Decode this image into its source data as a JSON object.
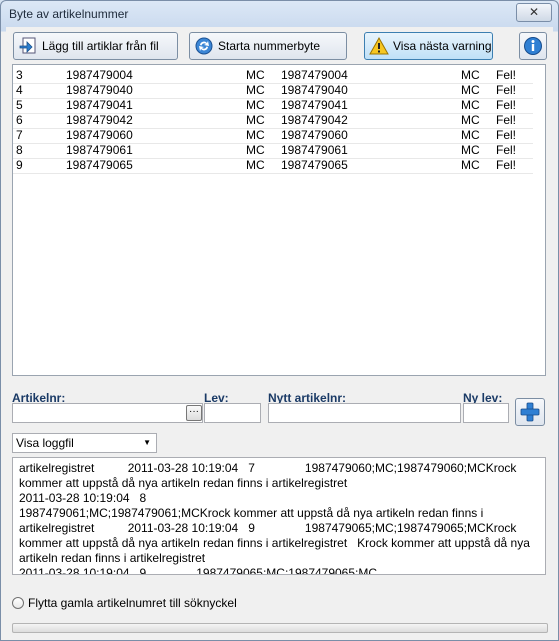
{
  "window": {
    "title": "Byte av artikelnummer",
    "close_glyph": "✕"
  },
  "toolbar": {
    "add_label": "Lägg till artiklar från fil",
    "start_label": "Starta nummerbyte",
    "warning_label": "Visa nästa varning"
  },
  "grid": {
    "rows": [
      [
        "3",
        "1987479004",
        "MC",
        "1987479004",
        "MC",
        "Fel!"
      ],
      [
        "4",
        "1987479040",
        "MC",
        "1987479040",
        "MC",
        "Fel!"
      ],
      [
        "5",
        "1987479041",
        "MC",
        "1987479041",
        "MC",
        "Fel!"
      ],
      [
        "6",
        "1987479042",
        "MC",
        "1987479042",
        "MC",
        "Fel!"
      ],
      [
        "7",
        "1987479060",
        "MC",
        "1987479060",
        "MC",
        "Fel!"
      ],
      [
        "8",
        "1987479061",
        "MC",
        "1987479061",
        "MC",
        "Fel!"
      ],
      [
        "9",
        "1987479065",
        "MC",
        "1987479065",
        "MC",
        "Fel!"
      ]
    ]
  },
  "form": {
    "artikelnr_label": "Artikelnr:",
    "lev_label": "Lev:",
    "nytt_label": "Nytt artikelnr:",
    "nylev_label": "Ny lev:",
    "browse_glyph": "···"
  },
  "log": {
    "selected": "Visa loggfil",
    "text": "artikelregistret          2011-03-28 10:19:04   7               1987479060;MC;1987479060;MCKrock\nkommer att uppstå då nya artikeln redan finns i artikelregistret\n2011-03-28 10:19:04   8\n1987479061;MC;1987479061;MCKrock kommer att uppstå då nya artikeln redan finns i\nartikelregistret          2011-03-28 10:19:04   9               1987479065;MC;1987479065;MCKrock\nkommer att uppstå då nya artikeln redan finns i artikelregistret   Krock kommer att uppstå då nya\nartikeln redan finns i artikelregistret\n2011-03-28 10:19:04   9               1987479065;MC;1987479065;MC"
  },
  "option": {
    "move_label": "Flytta gamla artikelnumret till söknyckel"
  },
  "progress": {
    "value": 0
  }
}
